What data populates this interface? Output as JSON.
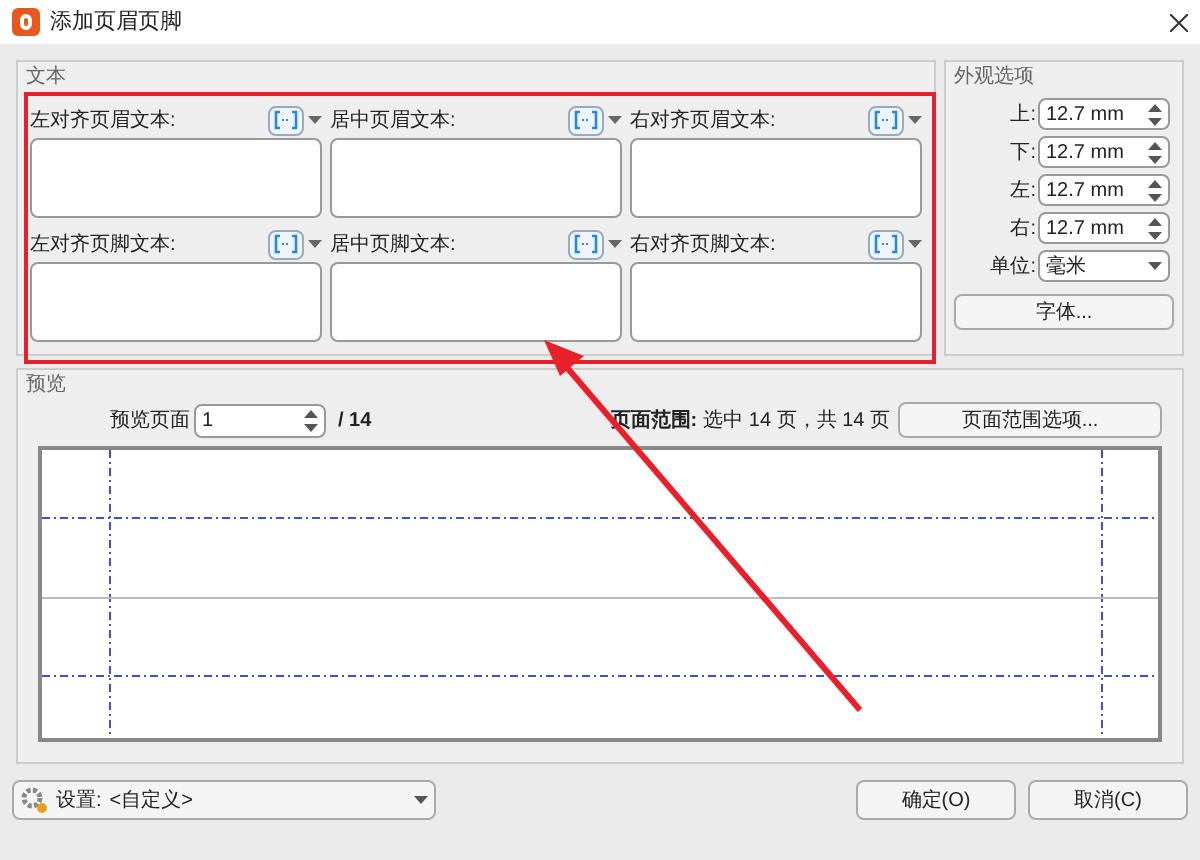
{
  "window": {
    "title": "添加页眉页脚"
  },
  "text_group": {
    "title": "文本",
    "fields": [
      {
        "label": "左对齐页眉文本:"
      },
      {
        "label": "居中页眉文本:"
      },
      {
        "label": "右对齐页眉文本:"
      },
      {
        "label": "左对齐页脚文本:"
      },
      {
        "label": "居中页脚文本:"
      },
      {
        "label": "右对齐页脚文本:"
      }
    ]
  },
  "appearance": {
    "title": "外观选项",
    "margins": [
      {
        "label": "上:",
        "value": "12.7 mm"
      },
      {
        "label": "下:",
        "value": "12.7 mm"
      },
      {
        "label": "左:",
        "value": "12.7 mm"
      },
      {
        "label": "右:",
        "value": "12.7 mm"
      }
    ],
    "unit_label": "单位:",
    "unit_value": "毫米",
    "font_button": "字体..."
  },
  "preview": {
    "title": "预览",
    "page_label": "预览页面",
    "page_value": "1",
    "page_total": "/ 14",
    "range_label": "页面范围:",
    "range_text": "选中 14 页，共 14 页",
    "range_button": "页面范围选项..."
  },
  "footer": {
    "settings_label": "设置:",
    "settings_value": "<自定义>",
    "buttons": [
      "确定(O)",
      "取消(C)"
    ]
  }
}
